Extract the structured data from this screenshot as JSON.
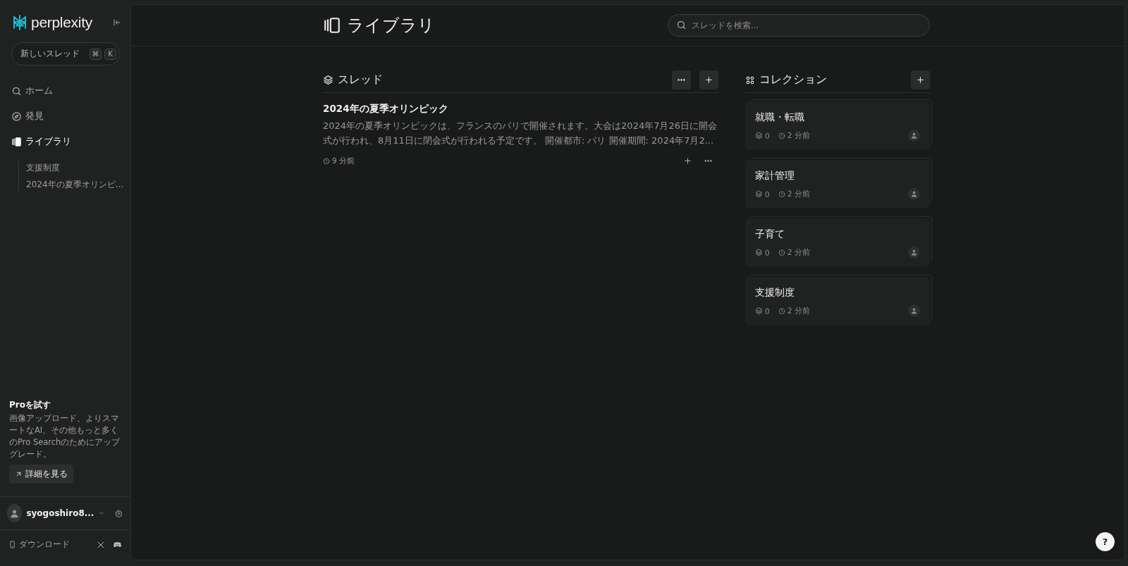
{
  "sidebar": {
    "logo": "perplexity",
    "new_thread": {
      "label": "新しいスレッド",
      "keys": [
        "⌘",
        "K"
      ]
    },
    "nav": [
      {
        "label": "ホーム",
        "selected": false
      },
      {
        "label": "発見",
        "selected": false
      },
      {
        "label": "ライブラリ",
        "selected": true
      }
    ],
    "library_items": [
      "支援制度",
      "2024年の夏季オリンピ…"
    ],
    "promo": {
      "title": "Proを試す",
      "body": "画像アップロード、よりスマートなAI、その他もっと多くのPro Searchのためにアップグレード。",
      "button": "詳細を見る"
    },
    "user": {
      "name": "syogoshiro8..."
    },
    "footer": {
      "download": "ダウンロード"
    }
  },
  "header": {
    "title": "ライブラリ",
    "search": {
      "placeholder": "スレッドを検索..."
    }
  },
  "threads": {
    "title": "スレッド",
    "items": [
      {
        "title": "2024年の夏季オリンピック",
        "snippet": "2024年の夏季オリンピックは、フランスのパリで開催されます。大会は2024年7月26日に開会式が行われ、8月11日に閉会式が行われる予定です。 開催都市: パリ 開催期間: 2024年7月2...",
        "time": "9 分前"
      }
    ]
  },
  "collections": {
    "title": "コレクション",
    "items": [
      {
        "title": "就職・転職",
        "count": "0",
        "time": "2 分前"
      },
      {
        "title": "家計管理",
        "count": "0",
        "time": "2 分前"
      },
      {
        "title": "子育て",
        "count": "0",
        "time": "2 分前"
      },
      {
        "title": "支援制度",
        "count": "0",
        "time": "2 分前"
      }
    ]
  },
  "help": "?"
}
